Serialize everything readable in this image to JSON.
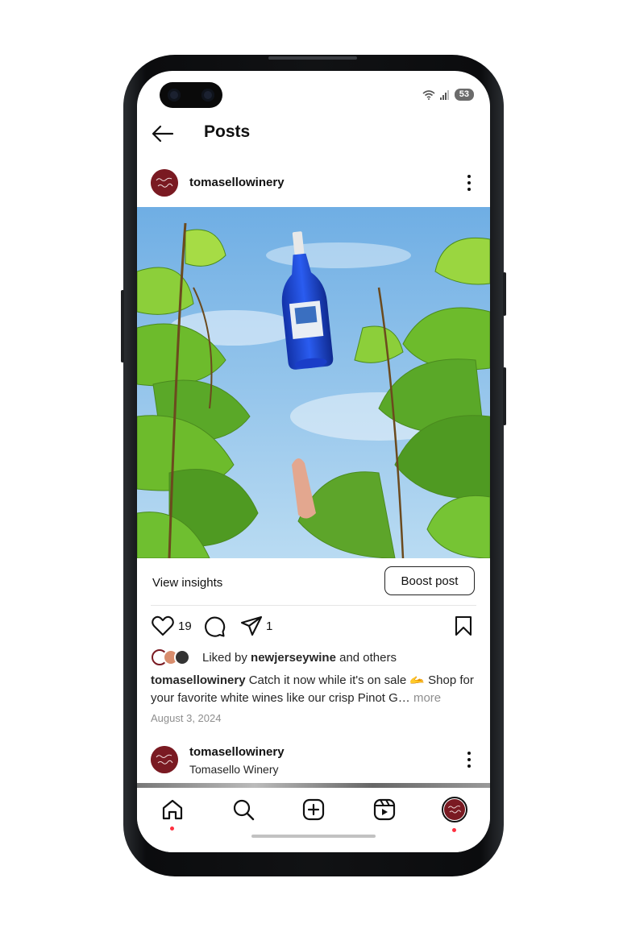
{
  "status_bar": {
    "battery": "53"
  },
  "header": {
    "title": "Posts"
  },
  "post": {
    "username": "tomasellowinery",
    "actions": {
      "likes_count": "19",
      "shares_count": "1"
    },
    "view_insights": "View insights",
    "boost": "Boost post",
    "liked_by_prefix": "Liked by ",
    "liked_by_user": "newjerseywine",
    "liked_by_suffix": " and others",
    "caption_user": "tomasellowinery",
    "caption_text": " Catch it now while it's on sale 🫴 Shop for your favorite white wines like our crisp Pinot G…",
    "caption_more": " more",
    "date": "August 3, 2024"
  },
  "next_post": {
    "username": "tomasellowinery",
    "subtitle": "Tomasello Winery"
  },
  "avatar_logo_text": "Tomasello Winery",
  "colors": {
    "brand": "#7a1a22",
    "notification_dot": "#ff3040",
    "sky": "#7fb8e6",
    "bottle": "#1f49d6"
  },
  "icons": [
    "back-arrow-icon",
    "wifi-icon",
    "signal-icon",
    "more-vertical-icon",
    "heart-icon",
    "comment-icon",
    "share-icon",
    "bookmark-icon",
    "home-icon",
    "search-icon",
    "create-icon",
    "reels-icon",
    "profile-icon"
  ]
}
